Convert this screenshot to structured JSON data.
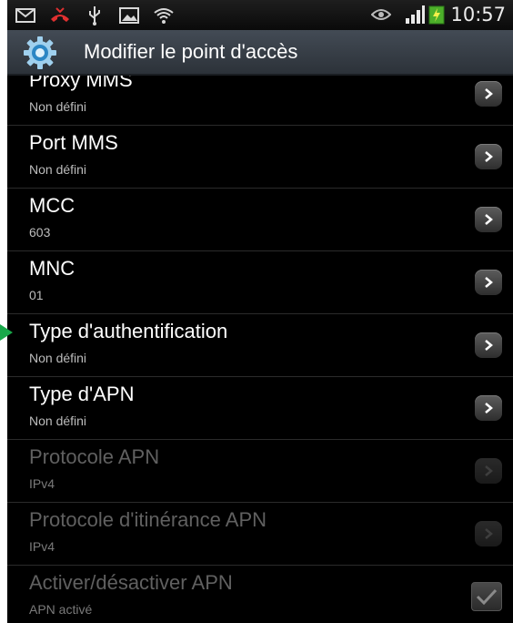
{
  "status_bar": {
    "time": "10:57",
    "icons": [
      "mail-icon",
      "missed-call-icon",
      "usb-icon",
      "image-icon",
      "wifi-icon",
      "eye-icon",
      "signal-icon",
      "battery-charging-icon"
    ]
  },
  "title_bar": {
    "title": "Modifier le point d'accès",
    "icon": "settings-gear-icon"
  },
  "items": [
    {
      "title": "Proxy MMS",
      "subtitle": "Non défini",
      "enabled": true,
      "control": "chevron"
    },
    {
      "title": "Port MMS",
      "subtitle": "Non défini",
      "enabled": true,
      "control": "chevron"
    },
    {
      "title": "MCC",
      "subtitle": "603",
      "enabled": true,
      "control": "chevron"
    },
    {
      "title": "MNC",
      "subtitle": "01",
      "enabled": true,
      "control": "chevron"
    },
    {
      "title": "Type d'authentification",
      "subtitle": "Non défini",
      "enabled": true,
      "control": "chevron"
    },
    {
      "title": "Type d'APN",
      "subtitle": "Non défini",
      "enabled": true,
      "control": "chevron"
    },
    {
      "title": "Protocole APN",
      "subtitle": "IPv4",
      "enabled": false,
      "control": "chevron"
    },
    {
      "title": "Protocole d'itinérance APN",
      "subtitle": "IPv4",
      "enabled": false,
      "control": "chevron"
    },
    {
      "title": "Activer/désactiver APN",
      "subtitle": "APN activé",
      "enabled": false,
      "control": "checkbox",
      "checked": true
    }
  ],
  "colors": {
    "background": "#000000",
    "title_bar": "#3a4148",
    "text_primary": "#ffffff",
    "text_secondary": "#bdbdbd",
    "text_disabled": "#606060",
    "pointer": "#19a84a"
  }
}
